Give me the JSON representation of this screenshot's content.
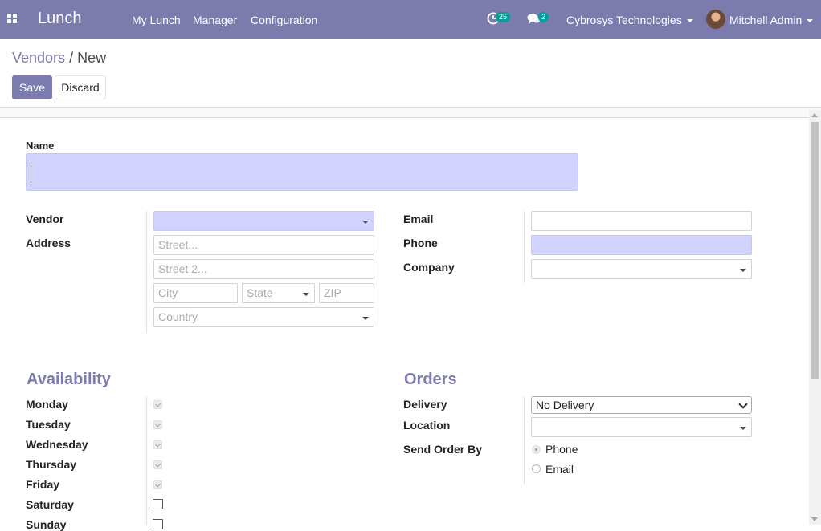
{
  "navbar": {
    "app_name": "Lunch",
    "menu": [
      "My Lunch",
      "Manager",
      "Configuration"
    ],
    "activity_count": "25",
    "message_count": "2",
    "company": "Cybrosys Technologies",
    "user": "Mitchell Admin",
    "colors": {
      "navbar": "#7c7bad",
      "badge": "#00a09d"
    }
  },
  "breadcrumb": {
    "parent": "Vendors",
    "separator": "/",
    "current": "New"
  },
  "buttons": {
    "save": "Save",
    "discard": "Discard"
  },
  "form": {
    "name_label": "Name",
    "vendor_label": "Vendor",
    "address_label": "Address",
    "placeholders": {
      "street": "Street...",
      "street2": "Street 2...",
      "city": "City",
      "state": "State",
      "zip": "ZIP",
      "country": "Country"
    },
    "email_label": "Email",
    "phone_label": "Phone",
    "company_label": "Company",
    "availability_title": "Availability",
    "days": [
      {
        "label": "Monday",
        "checked": true
      },
      {
        "label": "Tuesday",
        "checked": true
      },
      {
        "label": "Wednesday",
        "checked": true
      },
      {
        "label": "Thursday",
        "checked": true
      },
      {
        "label": "Friday",
        "checked": true
      },
      {
        "label": "Saturday",
        "checked": false
      },
      {
        "label": "Sunday",
        "checked": false
      }
    ],
    "orders_title": "Orders",
    "delivery_label": "Delivery",
    "delivery_value": "No Delivery",
    "location_label": "Location",
    "send_order_label": "Send Order By",
    "send_order_options": [
      {
        "label": "Phone",
        "selected": true
      },
      {
        "label": "Email",
        "selected": false
      }
    ]
  }
}
